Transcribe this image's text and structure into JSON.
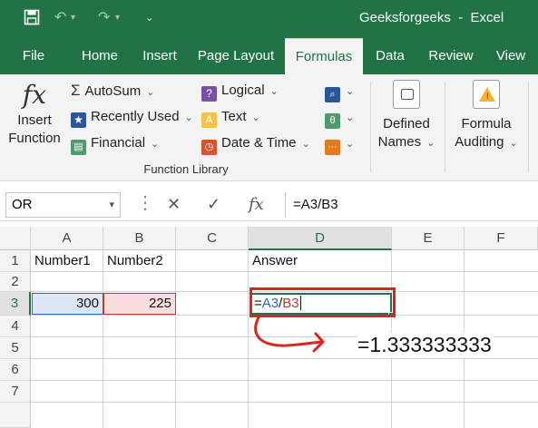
{
  "app": {
    "title": "Geeksforgeeks  -  Excel"
  },
  "menu": {
    "tabs": [
      "File",
      "Home",
      "Insert",
      "Page Layout",
      "Formulas",
      "Data",
      "Review",
      "View"
    ],
    "active": "Formulas"
  },
  "ribbon": {
    "insert_function": {
      "line1": "Insert",
      "line2": "Function",
      "icon_text": "fx"
    },
    "autosum": "AutoSum",
    "recently_used": "Recently Used",
    "financial": "Financial",
    "logical": "Logical",
    "text": "Text",
    "datetime": "Date & Time",
    "group_label": "Function Library",
    "defined_names": {
      "line1": "Defined",
      "line2": "Names"
    },
    "formula_auditing": {
      "line1": "Formula",
      "line2": "Auditing"
    }
  },
  "formula_bar": {
    "name_box": "OR",
    "formula": "=A3/B3",
    "fx": "fx"
  },
  "sheet": {
    "columns": [
      "A",
      "B",
      "C",
      "D",
      "E",
      "F"
    ],
    "rows": [
      "1",
      "2",
      "3",
      "4",
      "5",
      "6",
      "7"
    ],
    "cells": {
      "A1": "Number1",
      "B1": "Number2",
      "D1": "Answer",
      "A3": "300",
      "B3": "225",
      "D3_eq": "=",
      "D3_a": "A3",
      "D3_slash": "/",
      "D3_b": "B3"
    }
  },
  "annotation": {
    "result": "=1.333333333"
  },
  "colors": {
    "excel_green": "#217346",
    "ref_blue": "#2e66c4",
    "ref_red": "#c0392b",
    "highlight_red": "#d9251d"
  }
}
